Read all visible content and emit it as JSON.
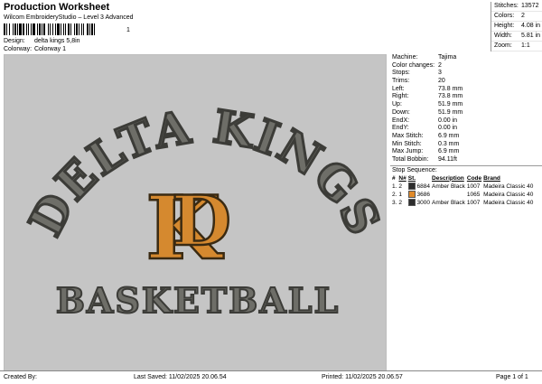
{
  "header": {
    "title": "Production Worksheet",
    "subtitle": "Wilcom EmbroideryStudio – Level 3 Advanced",
    "barcode_number": "1",
    "design_label": "Design:",
    "design_value": "delta kings 5,8in",
    "colorway_label": "Colorway:",
    "colorway_value": "Colorway 1"
  },
  "summary": [
    {
      "label": "Stitches:",
      "value": "13572"
    },
    {
      "label": "Colors:",
      "value": "2"
    },
    {
      "label": "Height:",
      "value": "4.08 in"
    },
    {
      "label": "Width:",
      "value": "5.81 in"
    },
    {
      "label": "Zoom:",
      "value": "1:1"
    }
  ],
  "machine_info": [
    {
      "label": "Machine:",
      "value": "Tajima"
    },
    {
      "label": "Color changes:",
      "value": "2"
    },
    {
      "label": "Stops:",
      "value": "3"
    },
    {
      "label": "Trims:",
      "value": "20"
    },
    {
      "label": "Left:",
      "value": "73.8 mm"
    },
    {
      "label": "Right:",
      "value": "73.8 mm"
    },
    {
      "label": "Up:",
      "value": "51.9 mm"
    },
    {
      "label": "Down:",
      "value": "51.9 mm"
    },
    {
      "label": "EndX:",
      "value": "0.00 in"
    },
    {
      "label": "EndY:",
      "value": "0.00 in"
    },
    {
      "label": "Max Stitch:",
      "value": "6.9 mm"
    },
    {
      "label": "Min Stitch:",
      "value": "0.3 mm"
    },
    {
      "label": "Max Jump:",
      "value": "6.9 mm"
    },
    {
      "label": "Total Bobbin:",
      "value": "94.11ft"
    }
  ],
  "stop_sequence": {
    "title": "Stop Sequence:",
    "columns": [
      "#",
      "N#",
      "St.",
      "Description",
      "Code",
      "Brand"
    ],
    "rows": [
      {
        "idx": "1.",
        "n": "2",
        "color": "#2d2d2d",
        "st": "6884",
        "desc": "Amber Black",
        "code": "1007",
        "brand": "Madeira Classic 40"
      },
      {
        "idx": "2.",
        "n": "1",
        "color": "#e08a2a",
        "st": "3686",
        "desc": "",
        "code": "1065",
        "brand": "Madeira Classic 40"
      },
      {
        "idx": "3.",
        "n": "2",
        "color": "#2d2d2d",
        "st": "3000",
        "desc": "Amber Black",
        "code": "1007",
        "brand": "Madeira Classic 40"
      }
    ]
  },
  "design": {
    "arc_text": "DELTA KINGS",
    "monogram_left": "K",
    "monogram_right": "D",
    "bottom_text": "BASKETBALL",
    "thread_dark": "#4a4a46",
    "thread_orange": "#d5892f",
    "background": "#c5c5c5"
  },
  "footer": {
    "created_by": "Created By:",
    "last_saved": "Last Saved: 11/02/2025 20.06.54",
    "printed": "Printed: 11/02/2025 20.06.57",
    "page": "Page 1 of 1"
  }
}
